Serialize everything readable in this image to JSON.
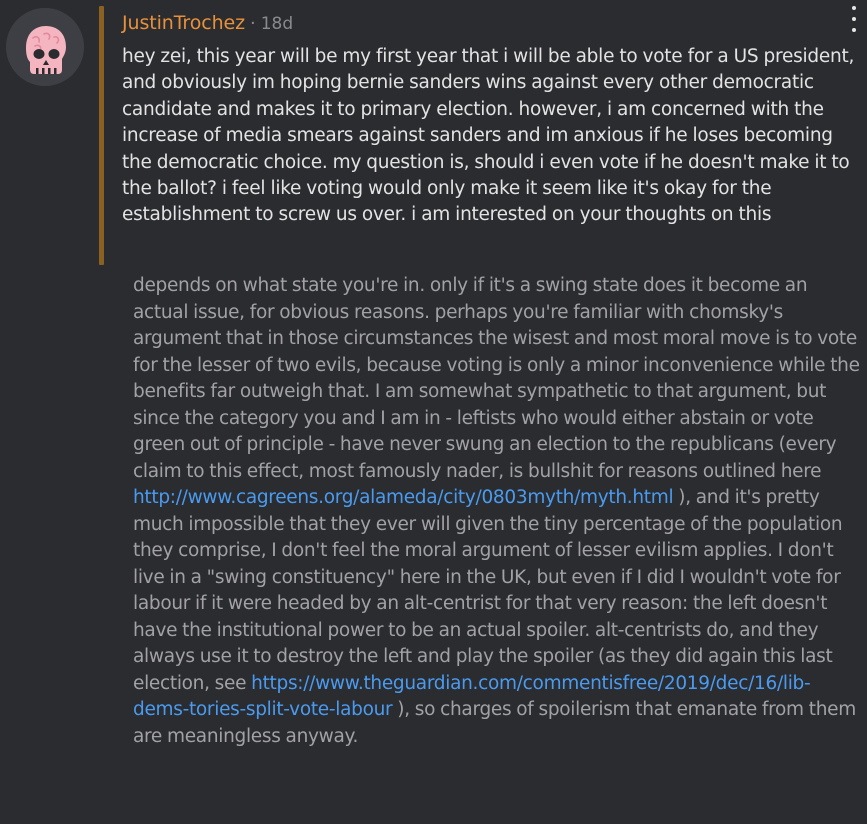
{
  "post": {
    "author": "JustinTrochez",
    "separator": "·",
    "age": "18d",
    "avatar_icon": "pink-skull-icon",
    "menu_icon": "vertical-ellipsis-icon",
    "question": "hey zei, this year will be my first year that i will be able to vote for a US president, and obviously im hoping bernie sanders wins against every other democratic candidate and makes it to primary election. however, i am concerned with the increase of media smears against sanders and im anxious if he loses becoming the democratic choice. my question is, should i even vote if he doesn't make it to the ballot? i feel like voting would only make it seem like it's okay for the establishment to screw us over. i am interested on your thoughts on this"
  },
  "answer": {
    "part1": "depends on what state you're in. only if it's a swing state does it become an actual issue, for obvious reasons. perhaps you're familiar with chomsky's argument that in those circumstances the wisest and most moral move is to vote for the lesser of two evils, because voting is only a minor inconvenience while the benefits far outweigh that. I am somewhat sympathetic to that argument, but since the category you and I am in - leftists who would either abstain or vote green out of principle - have never swung an election to the republicans (every claim to this effect, most famously nader, is bullshit for reasons outlined here ",
    "link1": "http://www.cagreens.org/alameda/city/0803myth/myth.html",
    "part2": " ), and it's pretty much impossible that they ever will given the tiny percentage of the population they comprise, I don't feel the moral argument of lesser evilism applies. I don't live in a \"swing constituency\" here in the UK, but even if I did I wouldn't vote for labour if it were headed by an alt-centrist for that very reason: the left doesn't have the institutional power to be an actual spoiler. alt-centrists do, and they always use it to destroy the left and play the spoiler (as they did again this last election, see ",
    "link2": "https://www.theguardian.com/commentisfree/2019/dec/16/lib-dems-tories-split-vote-labour",
    "part3": " ), so charges of spoilerism that emanate from them are meaningless anyway."
  },
  "colors": {
    "background": "#2b2c30",
    "author": "#e8913b",
    "quote_bar": "#8a6120",
    "question_text": "#e3e3e3",
    "answer_text": "#a2a2a6",
    "link": "#4a9bf0"
  }
}
